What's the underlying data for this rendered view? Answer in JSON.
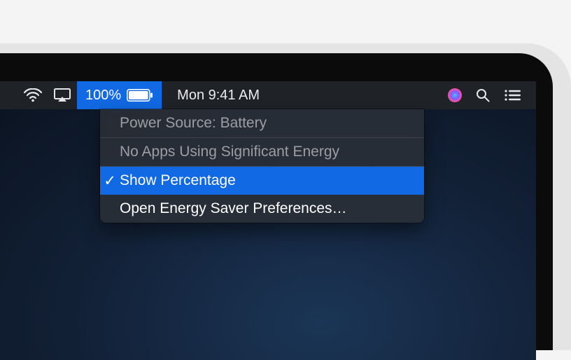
{
  "menubar": {
    "battery_percent": "100%",
    "clock": "Mon 9:41 AM"
  },
  "dropdown": {
    "power_source": "Power Source: Battery",
    "energy_info": "No Apps Using Significant Energy",
    "show_percentage": "Show Percentage",
    "open_prefs": "Open Energy Saver Preferences…",
    "checkmark": "✓"
  },
  "colors": {
    "accent": "#1169e3"
  }
}
